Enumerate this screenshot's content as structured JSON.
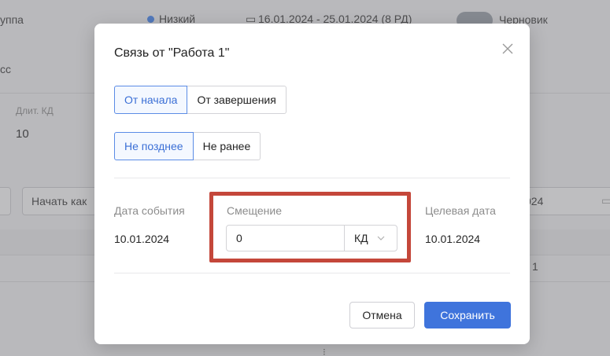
{
  "background": {
    "group_label": "уппа",
    "priority_label": "Низкий",
    "date_range": "16.01.2024 - 25.01.2024 (8 РД)",
    "draft_label": "Черновик",
    "process_label": "сс",
    "duration_header": "Длит. КД",
    "duration_value": "10",
    "start_label": "Начать как",
    "right_date_fragment": "024",
    "row_value": "1",
    "colors": {
      "accent": "#3b82f6"
    }
  },
  "modal": {
    "title": "Связь от \"Работа 1\"",
    "close_icon": "close-icon",
    "anchor_options": [
      {
        "label": "От начала",
        "active": true
      },
      {
        "label": "От завершения",
        "active": false
      }
    ],
    "constraint_options": [
      {
        "label": "Не позднее",
        "active": true
      },
      {
        "label": "Не ранее",
        "active": false
      }
    ],
    "event_date": {
      "label": "Дата события",
      "value": "10.01.2024"
    },
    "offset": {
      "label": "Смещение",
      "value": "0",
      "unit": "КД"
    },
    "target_date": {
      "label": "Целевая дата",
      "value": "10.01.2024"
    },
    "buttons": {
      "cancel": "Отмена",
      "save": "Сохранить"
    },
    "colors": {
      "primary": "#3f74dc",
      "active_text": "#3b6fd6",
      "highlight": "#c4473a"
    }
  }
}
